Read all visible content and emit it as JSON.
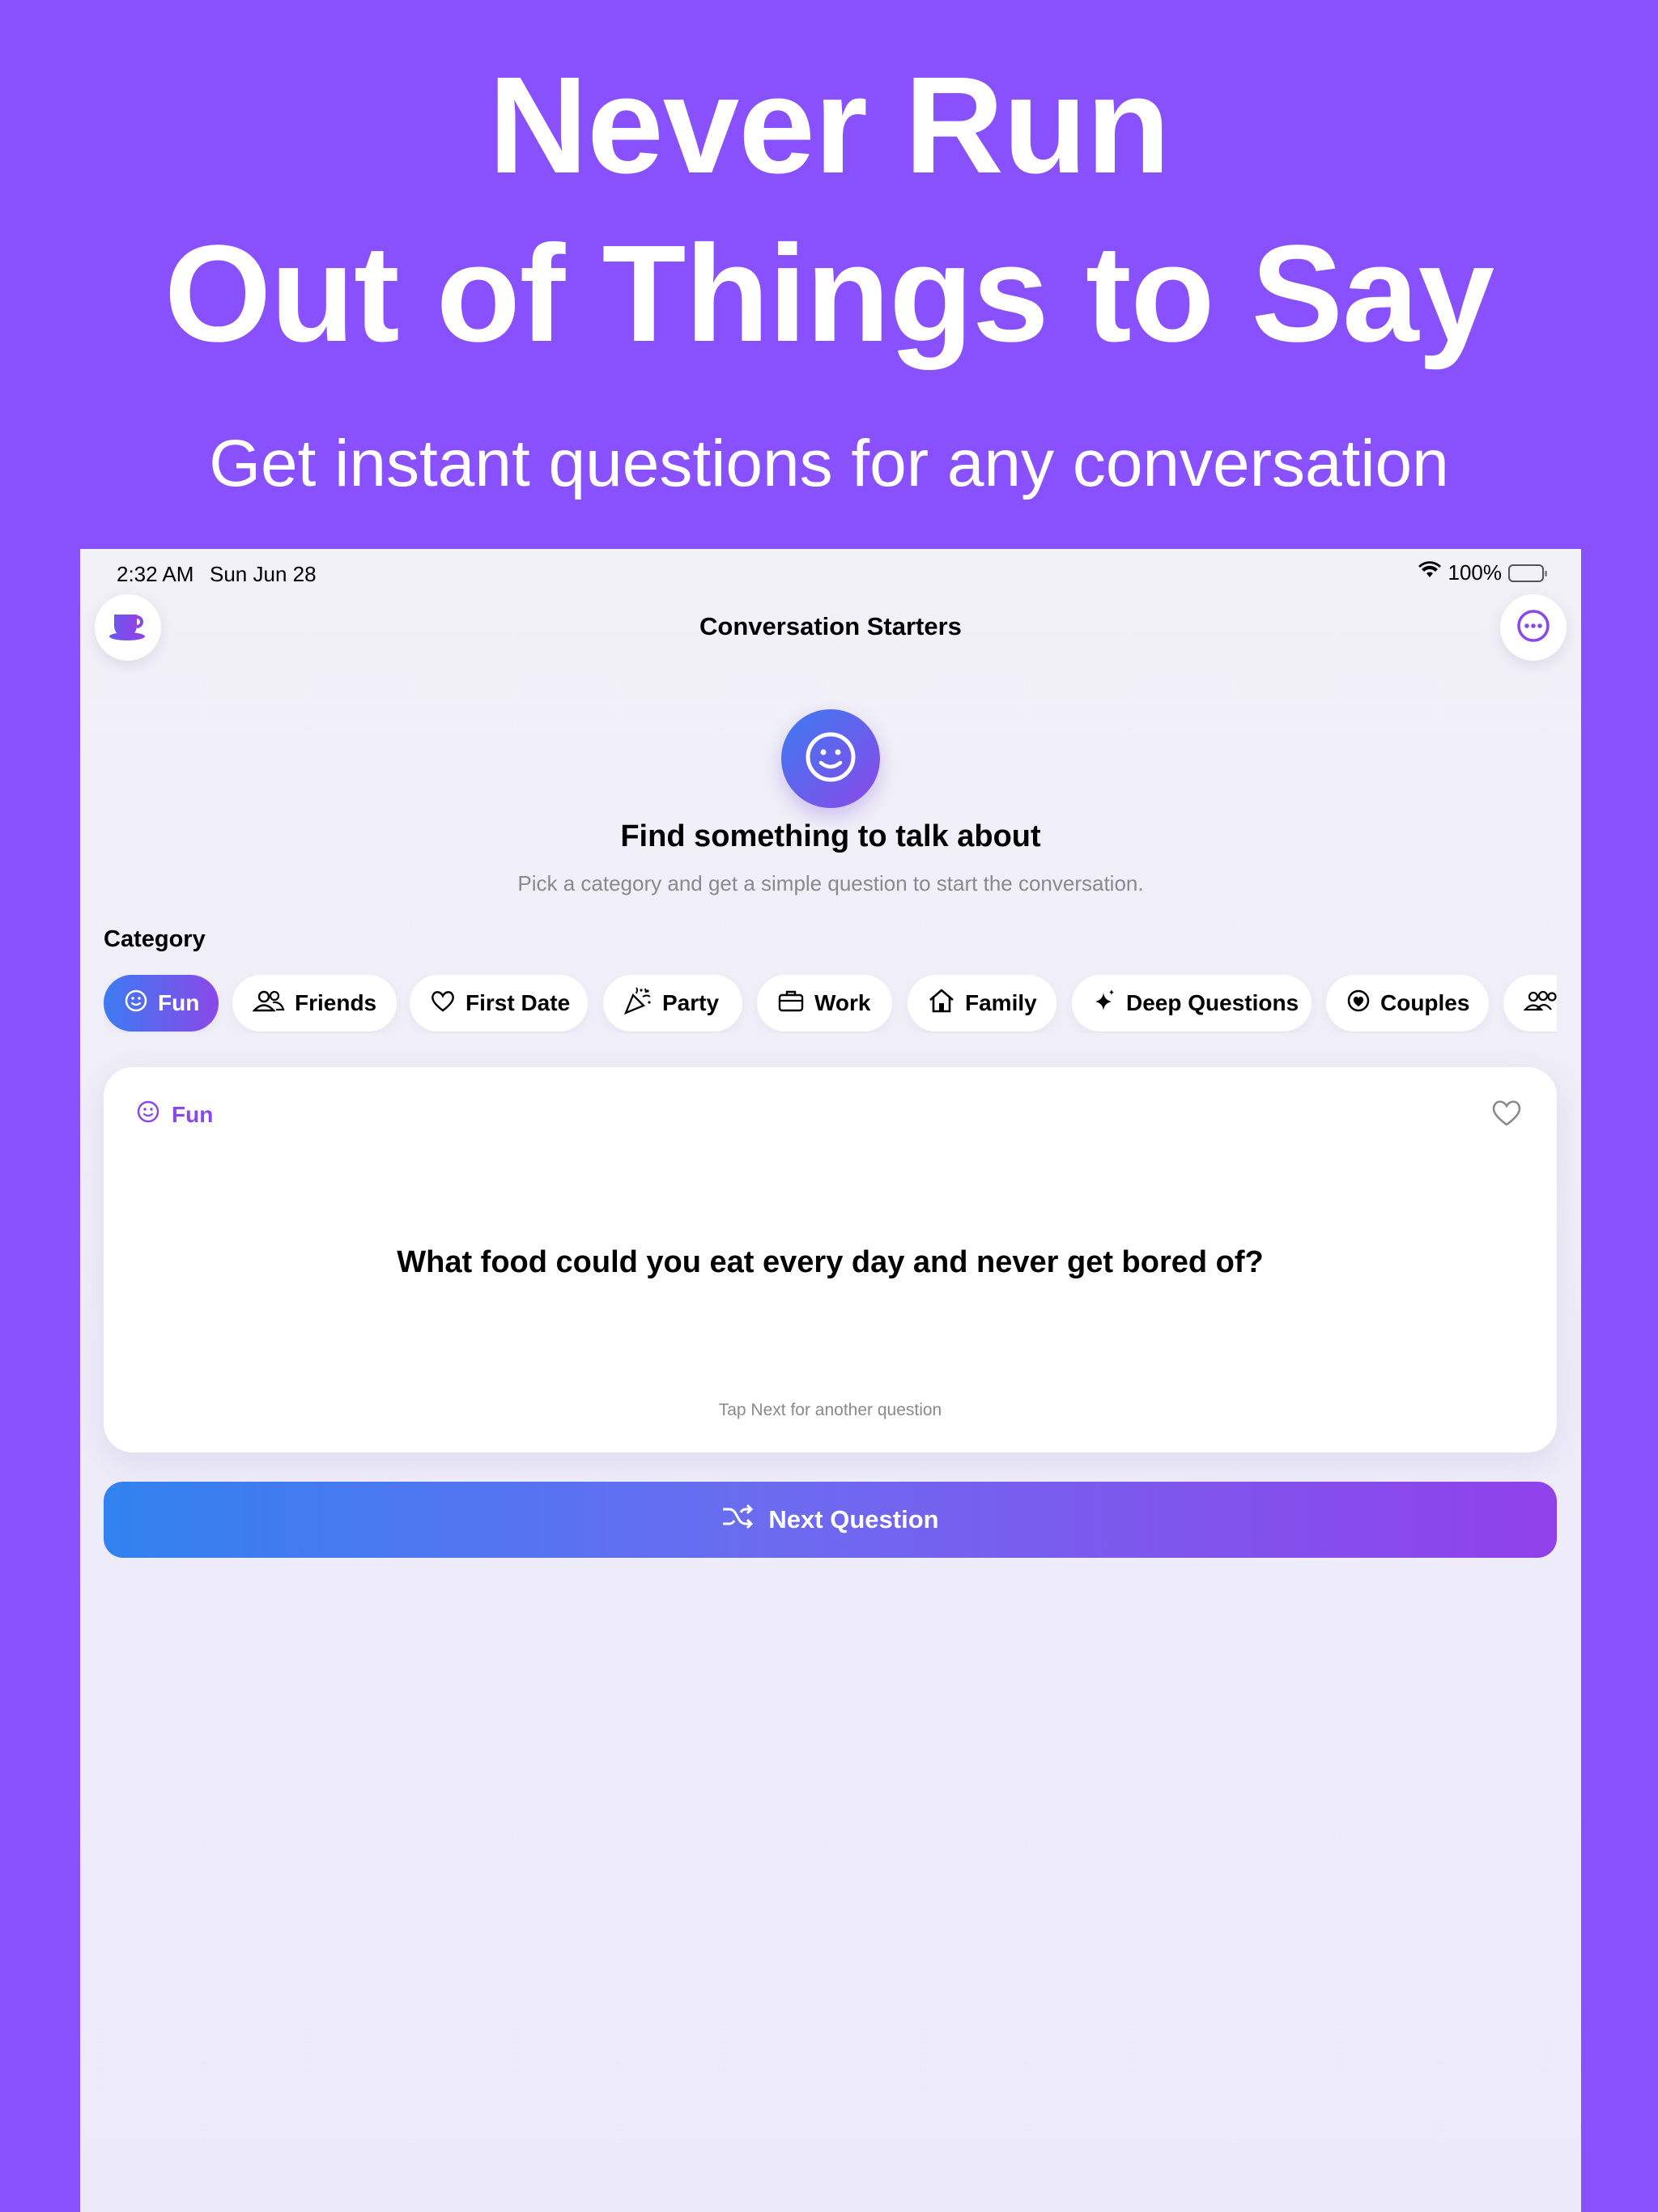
{
  "promo": {
    "headline_line1": "Never Run",
    "headline_line2": "Out of Things to Say",
    "subheadline": "Get instant questions for any conversation"
  },
  "status_bar": {
    "time": "2:32 AM",
    "date": "Sun Jun 28",
    "battery": "100%"
  },
  "nav": {
    "title": "Conversation Starters",
    "left_icon": "cup-icon",
    "right_icon": "more-icon"
  },
  "hero": {
    "icon": "smiley-icon",
    "title": "Find something to talk about",
    "subtitle": "Pick a category and get a simple question to start the conversation."
  },
  "category": {
    "label": "Category",
    "chips": [
      {
        "label": "Fun",
        "icon": "smiley-icon",
        "selected": true
      },
      {
        "label": "Friends",
        "icon": "people-icon",
        "selected": false
      },
      {
        "label": "First Date",
        "icon": "heart-icon",
        "selected": false
      },
      {
        "label": "Party",
        "icon": "party-popper-icon",
        "selected": false
      },
      {
        "label": "Work",
        "icon": "briefcase-icon",
        "selected": false
      },
      {
        "label": "Family",
        "icon": "house-icon",
        "selected": false
      },
      {
        "label": "Deep Questions",
        "icon": "sparkles-icon",
        "selected": false
      },
      {
        "label": "Couples",
        "icon": "heart-circle-icon",
        "selected": false
      },
      {
        "label": "",
        "icon": "group-icon",
        "selected": false
      }
    ]
  },
  "card": {
    "category": "Fun",
    "question": "What food could you eat every day and never get bored of?",
    "hint": "Tap Next for another question"
  },
  "next_button": {
    "label": "Next Question",
    "icon": "shuffle-icon"
  },
  "colors": {
    "background": "#8951FD",
    "accent_blue": "#3D7BF1",
    "accent_purple": "#8B48E9"
  }
}
